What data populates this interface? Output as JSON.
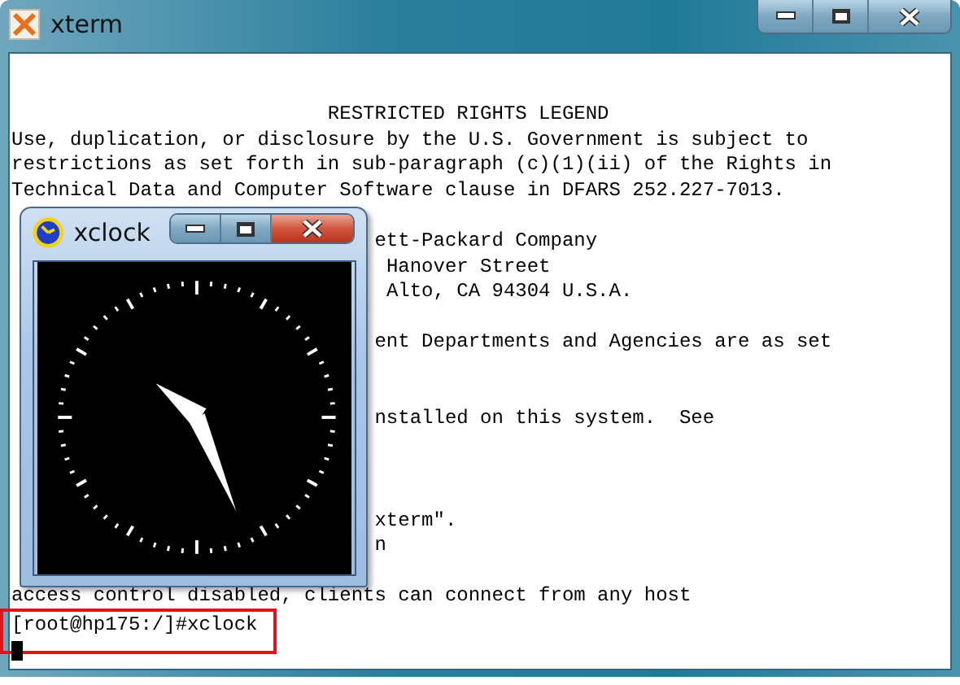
{
  "xterm": {
    "title": "xterm",
    "active": false,
    "lines": [
      "                           RESTRICTED RIGHTS LEGEND",
      "Use, duplication, or disclosure by the U.S. Government is subject to",
      "restrictions as set forth in sub-paragraph (c)(1)(ii) of the Rights in",
      "Technical Data and Computer Software clause in DFARS 252.227-7013.\n",
      "                               ett-Packard Company",
      "                                Hanover Street",
      "                                Alto, CA 94304 U.S.A.\n",
      "                               ent Departments and Agencies are as set\n\n",
      "                               nstalled on this system.  See\n\n\n",
      "                               xterm\".",
      "                               n\n",
      "access control disabled, clients can connect from any host"
    ],
    "prompt": "[root@hp175:/]#xclock"
  },
  "xclock": {
    "title": "xclock",
    "active": true
  }
}
